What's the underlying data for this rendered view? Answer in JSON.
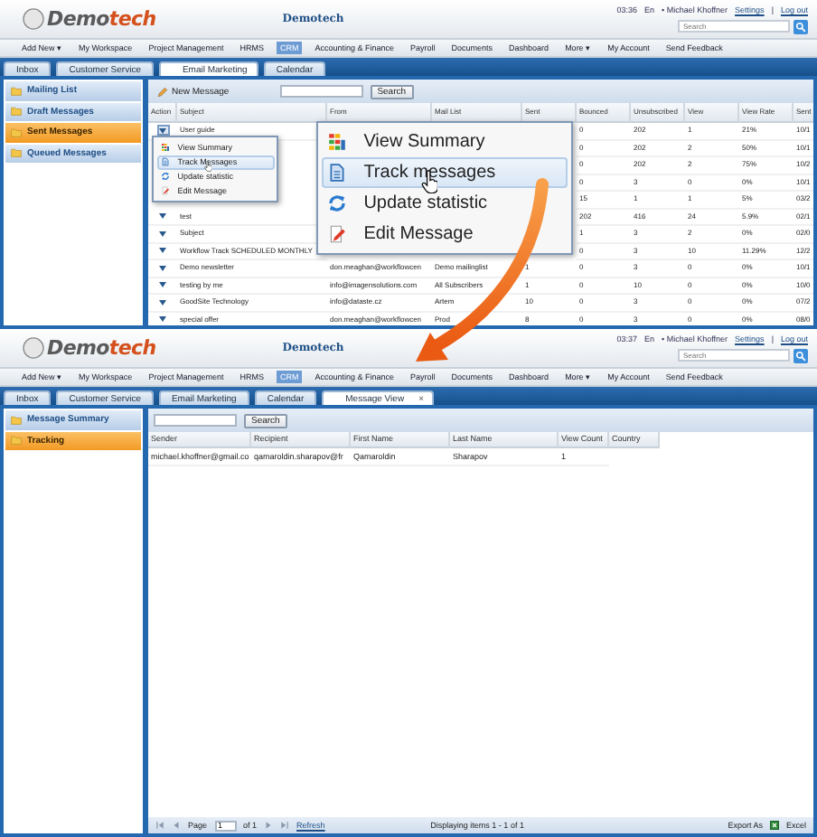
{
  "top_screen": {
    "header": {
      "logo": [
        "Demo",
        "tech"
      ],
      "title": "Demotech",
      "time": "03:36",
      "language": "En",
      "user": "• Michael Khoffner",
      "settings_link": "Settings",
      "divider": "|",
      "logout_link": "Log out",
      "search_placeholder": "Search"
    },
    "nav": [
      {
        "label": "Add New ▾",
        "selected": false
      },
      {
        "label": "My Workspace",
        "selected": false
      },
      {
        "label": "Project Management",
        "selected": false
      },
      {
        "label": "HRMS",
        "selected": false
      },
      {
        "label": "CRM",
        "selected": true
      },
      {
        "label": "Accounting & Finance",
        "selected": false
      },
      {
        "label": "Payroll",
        "selected": false
      },
      {
        "label": "Documents",
        "selected": false
      },
      {
        "label": "Dashboard",
        "selected": false
      },
      {
        "label": "More ▾",
        "selected": false
      },
      {
        "label": "My Account",
        "selected": false
      },
      {
        "label": "Send Feedback",
        "selected": false
      }
    ],
    "tabs": [
      {
        "label": "Inbox",
        "selected": false
      },
      {
        "label": "Customer Service",
        "selected": false
      },
      {
        "label": "Email Marketing",
        "selected": true
      },
      {
        "label": "Calendar",
        "selected": false
      }
    ],
    "sidebar": [
      {
        "label": "Mailing List",
        "selected": false
      },
      {
        "label": "Draft Messages",
        "selected": false
      },
      {
        "label": "Sent Messages",
        "selected": true
      },
      {
        "label": "Queued Messages",
        "selected": false
      }
    ],
    "toolbar": {
      "new_button": "New Message",
      "search_button": "Search"
    },
    "table": {
      "kind": "messages",
      "action_header": "Action",
      "columns": [
        "Subject",
        "From",
        "Mail List",
        "Sent",
        "Bounced",
        "Unsubscribed",
        "View",
        "View Rate",
        "Sent"
      ],
      "rows": [
        {
          "menu_open": true,
          "cells": [
            "User guide",
            null,
            null,
            null,
            "0",
            "202",
            "1",
            "21%",
            "10/1"
          ]
        },
        {
          "cells": [
            null,
            null,
            null,
            null,
            "0",
            "202",
            "2",
            "50%",
            "10/1"
          ]
        },
        {
          "cells": [
            null,
            null,
            null,
            null,
            "0",
            "202",
            "2",
            "75%",
            "10/2"
          ]
        },
        {
          "cells": [
            null,
            null,
            null,
            null,
            "0",
            "3",
            "0",
            "0%",
            "10/1"
          ]
        },
        {
          "cells": [
            null,
            null,
            null,
            null,
            "15",
            "1",
            "1",
            "5%",
            "03/2"
          ]
        },
        {
          "menu_open": false,
          "cells": [
            "test",
            null,
            null,
            null,
            "202",
            "416",
            "24",
            "5.9%",
            "02/1"
          ]
        },
        {
          "menu_open": false,
          "cells": [
            "Subject",
            null,
            null,
            null,
            "1",
            "3",
            "2",
            "0%",
            "02/0"
          ]
        },
        {
          "menu_open": false,
          "cells": [
            "Workflow Track SCHEDULED MONTHLY",
            null,
            null,
            null,
            "0",
            "3",
            "10",
            "11.29%",
            "12/2"
          ]
        },
        {
          "menu_open": false,
          "cells": [
            "Demo newsletter",
            "don.meaghan@workflowcen",
            "Demo mailinglist",
            "1",
            "0",
            "3",
            "0",
            "0%",
            "10/1"
          ]
        },
        {
          "menu_open": false,
          "cells": [
            "testing by me",
            "info@imagensolutions.com",
            "All Subscribers",
            "1",
            "0",
            "10",
            "0",
            "0%",
            "10/0"
          ]
        },
        {
          "menu_open": false,
          "cells": [
            "GoodSite Technology",
            "info@dataste.cz",
            "Artem",
            "10",
            "0",
            "3",
            "0",
            "0%",
            "07/2"
          ]
        },
        {
          "menu_open": false,
          "cells": [
            "special offer",
            "don.meaghan@workflowcen",
            "Prod",
            "8",
            "0",
            "3",
            "0",
            "0%",
            "08/0"
          ]
        }
      ]
    }
  },
  "context_menu": {
    "items": [
      {
        "kind": "summary",
        "label": "View Summary",
        "selected": false
      },
      {
        "kind": "track",
        "label": "Track Messages",
        "selected": true
      },
      {
        "kind": "update",
        "label": "Update statistic",
        "selected": false
      },
      {
        "kind": "edit",
        "label": "Edit Message",
        "selected": false
      }
    ]
  },
  "zoom_callout": {
    "items": [
      {
        "kind": "summary",
        "label": "View Summary",
        "selected": false
      },
      {
        "kind": "track",
        "label": "Track messages",
        "selected": true
      },
      {
        "kind": "update",
        "label": "Update statistic",
        "selected": false
      },
      {
        "kind": "edit",
        "label": "Edit Message",
        "selected": false
      }
    ]
  },
  "bottom_screen": {
    "header": {
      "logo": [
        "Demo",
        "tech"
      ],
      "title": "Demotech",
      "time": "03:37",
      "language": "En",
      "user": "• Michael Khoffner",
      "settings_link": "Settings",
      "divider": "|",
      "logout_link": "Log out",
      "search_placeholder": "Search"
    },
    "nav": [
      {
        "label": "Add New ▾",
        "selected": false
      },
      {
        "label": "My Workspace",
        "selected": false
      },
      {
        "label": "Project Management",
        "selected": false
      },
      {
        "label": "HRMS",
        "selected": false
      },
      {
        "label": "CRM",
        "selected": true
      },
      {
        "label": "Accounting & Finance",
        "selected": false
      },
      {
        "label": "Payroll",
        "selected": false
      },
      {
        "label": "Documents",
        "selected": false
      },
      {
        "label": "Dashboard",
        "selected": false
      },
      {
        "label": "More ▾",
        "selected": false
      },
      {
        "label": "My Account",
        "selected": false
      },
      {
        "label": "Send Feedback",
        "selected": false
      }
    ],
    "tabs": [
      {
        "label": "Inbox",
        "selected": false
      },
      {
        "label": "Customer Service",
        "selected": false
      },
      {
        "label": "Email Marketing",
        "selected": false
      },
      {
        "label": "Calendar",
        "selected": false
      },
      {
        "label": "Message View",
        "close": "×",
        "selected": true
      }
    ],
    "sidebar": [
      {
        "label": "Message Summary",
        "selected": false
      },
      {
        "label": "Tracking",
        "selected": true
      }
    ],
    "toolbar": {
      "search_button": "Search"
    },
    "table": {
      "kind": "tracking",
      "columns": [
        "Sender",
        "Recipient",
        "First Name",
        "Last Name",
        "View Count",
        "Country"
      ],
      "rows": [
        {
          "cells": [
            "michael.khoffner@gmail.co",
            "qamaroldin.sharapov@fr",
            "Qamaroldin",
            "Sharapov",
            "1",
            null
          ]
        }
      ]
    },
    "footer": {
      "page_label": "Page",
      "page_value": "1",
      "page_total": "of 1",
      "refresh": "Refresh",
      "status": "Displaying items 1 - 1 of 1",
      "export_label": "Export As",
      "export_format": "Excel"
    }
  }
}
